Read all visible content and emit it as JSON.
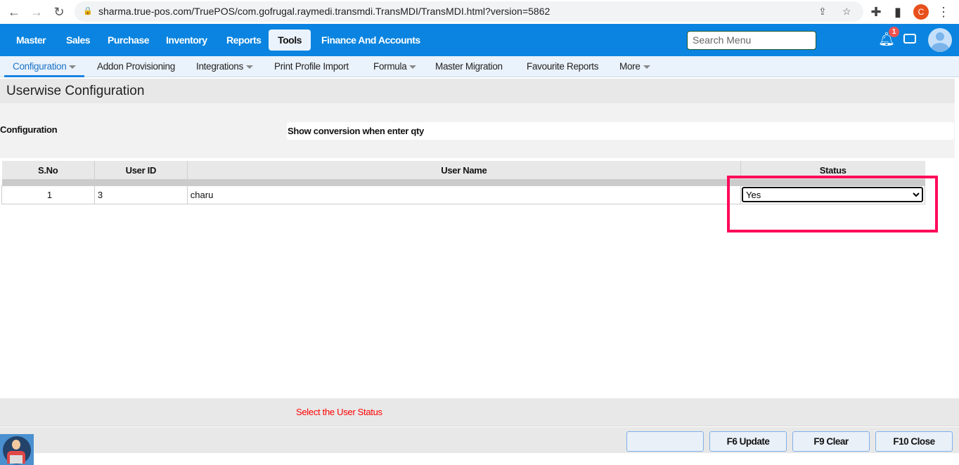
{
  "browser": {
    "url": "sharma.true-pos.com/TruePOS/com.gofrugal.raymedi.transmdi.TransMDI/TransMDI.html?version=5862",
    "profile_initial": "C"
  },
  "topnav": {
    "items": [
      "Master",
      "Sales",
      "Purchase",
      "Inventory",
      "Reports",
      "Tools",
      "Finance And Accounts"
    ],
    "search_placeholder": "Search Menu",
    "notification_count": "1"
  },
  "subnav": {
    "items": [
      "Configuration",
      "Addon Provisioning",
      "Integrations",
      "Print Profile Import",
      "Formula",
      "Master Migration",
      "Favourite Reports",
      "More"
    ]
  },
  "page": {
    "title": "Userwise Configuration",
    "config_label": "Configuration",
    "config_value": "Show conversion when enter qty"
  },
  "table": {
    "headers": [
      "S.No",
      "User ID",
      "User Name",
      "Status"
    ],
    "rows": [
      {
        "sno": "1",
        "user_id": "3",
        "user_name": "charu",
        "status": "Yes"
      }
    ]
  },
  "footer": {
    "status_message": "Select the User Status",
    "buttons": [
      "",
      "F6 Update",
      "F9 Clear",
      "F10 Close"
    ]
  },
  "colors": {
    "brand": "#0a84e0",
    "highlight": "#ff0a5a",
    "message": "#ff0000"
  }
}
